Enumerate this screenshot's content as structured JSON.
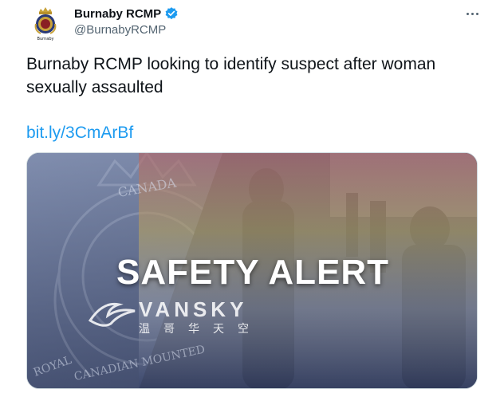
{
  "account": {
    "display_name": "Burnaby RCMP",
    "handle": "@BurnabyRCMP",
    "avatar_caption": "Burnaby",
    "verified_icon": "verified-badge-icon"
  },
  "tweet": {
    "text": "Burnaby RCMP looking to identify suspect after woman sexually assaulted",
    "link": "bit.ly/3CmArBf"
  },
  "media": {
    "headline": "SAFETY ALERT",
    "watermark": "VANSKY",
    "watermark_sub": "温哥华天空",
    "crest_text_top": "CANADA",
    "crest_text_bottom": "CANADIAN MOUNTED",
    "crest_text_left": "ROYAL"
  },
  "colors": {
    "link": "#1d9bf0",
    "verified": "#1d9bf0",
    "secondary_text": "#536471",
    "border": "#cfd9de"
  }
}
